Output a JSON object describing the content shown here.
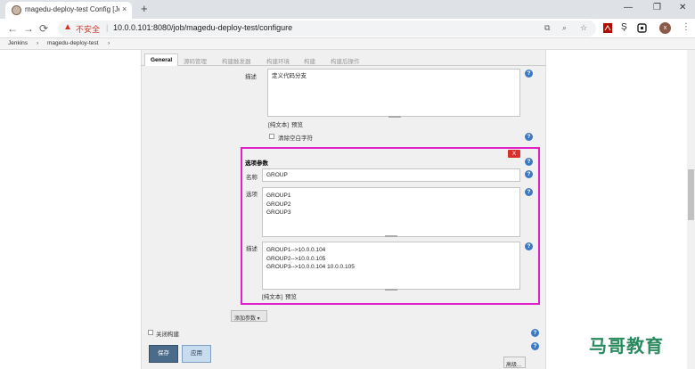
{
  "browser": {
    "tab_title": "magedu-deploy-test Config [Je",
    "tab_close": "×",
    "new_tab": "+",
    "window_controls": {
      "minimize": "—",
      "maximize": "❐",
      "close": "✕"
    },
    "insecure_label": "不安全",
    "url_sep": "|",
    "url": "10.0.0.101:8080/job/magedu-deploy-test/configure",
    "avatar_letter": "x"
  },
  "breadcrumb": {
    "items": [
      "Jenkins",
      "›",
      "magedu-deploy-test",
      "›"
    ]
  },
  "config_tabs": [
    "General",
    "源码管理",
    "构建触发器",
    "构建环境",
    "构建",
    "构建后操作"
  ],
  "desc_section": {
    "label": "描述",
    "value": "定义代码分支",
    "plain_text": "[纯文本]",
    "preview": "预览",
    "trim_label": "清除空白字符"
  },
  "choice_param": {
    "header": "选项参数",
    "delete_label": "X",
    "name_label": "名称",
    "name_value": "GROUP",
    "choices_label": "选项",
    "choices_value": "GROUP1\nGROUP2\nGROUP3",
    "desc_label": "描述",
    "desc_value": "GROUP1-->10.0.0.104\nGROUP2-->10.0.0.105\nGROUP3-->10.0.0.104 10.0.0.105",
    "plain_text": "[纯文本]",
    "preview": "预览"
  },
  "add_param_label": "添加参数 ▾",
  "disable_build_label": "关闭构建",
  "buttons": {
    "save": "保存",
    "apply": "应用",
    "advanced": "高级..."
  },
  "help_glyph": "?",
  "watermark": "马哥教育"
}
